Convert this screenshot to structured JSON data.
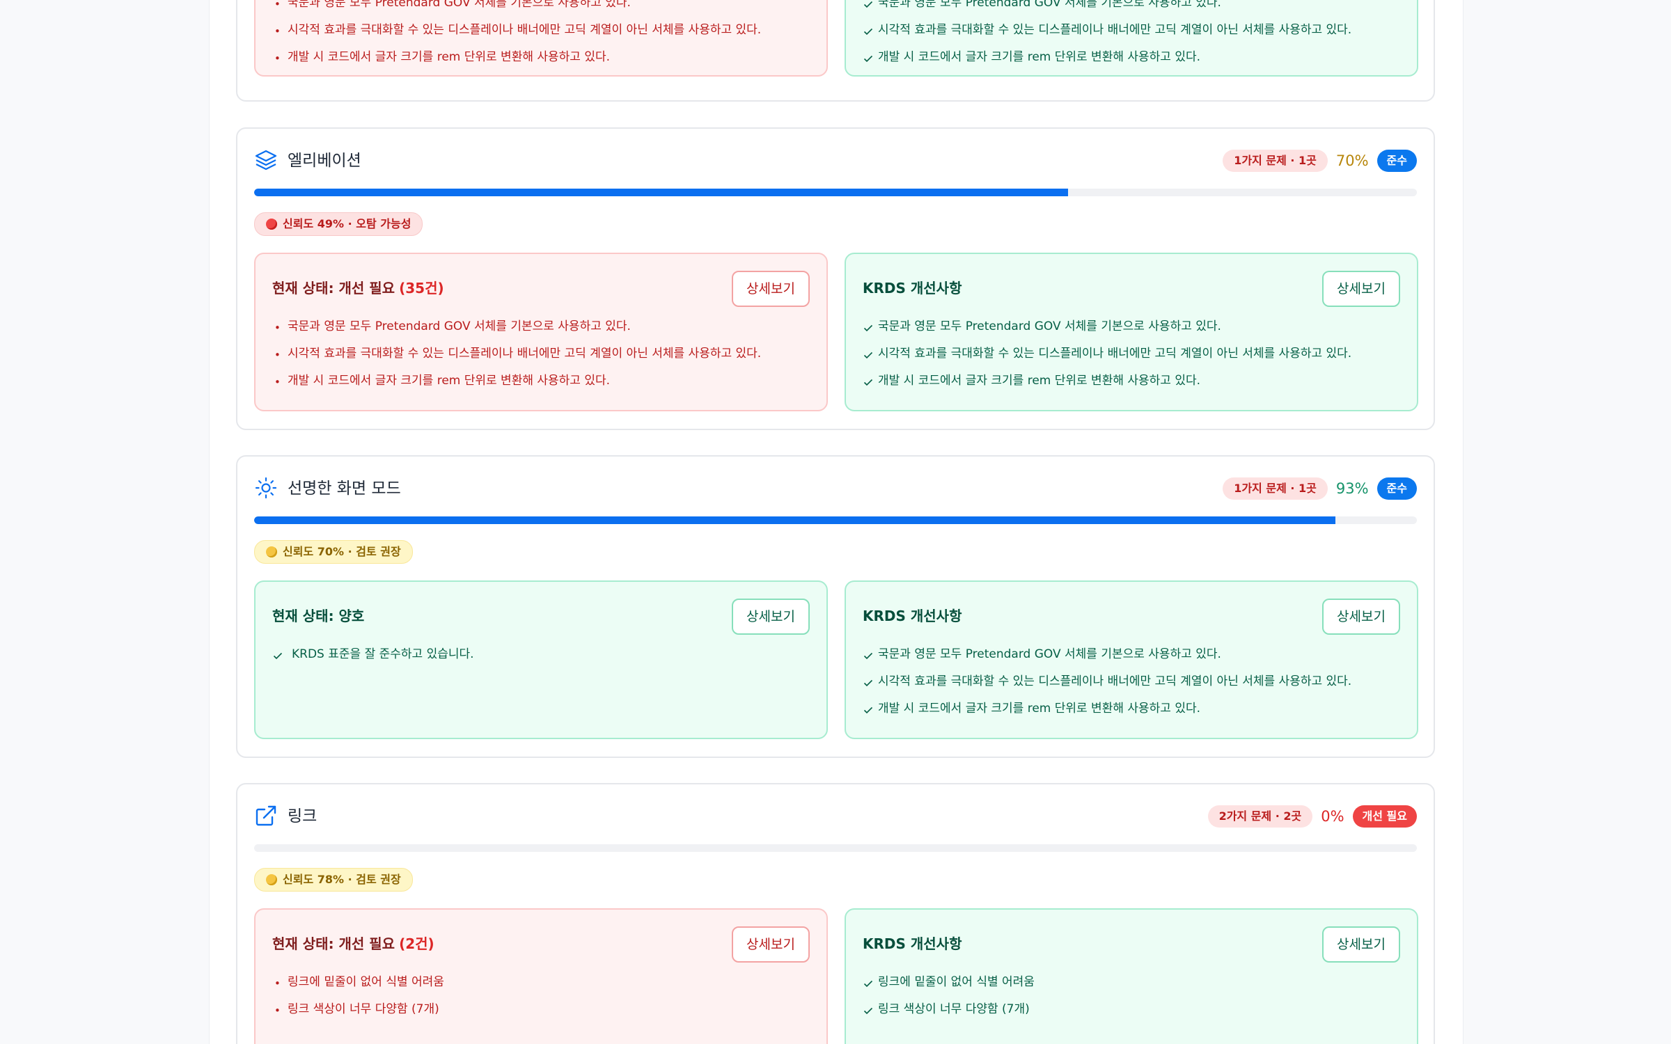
{
  "labels": {
    "details": "상세보기",
    "krds_title": "KRDS 개선사항"
  },
  "cards": [
    {
      "top_clip": true,
      "current": {
        "items": [
          "국문과 영문 모두 Pretendard GOV 서체를 기본으로 사용하고 있다.",
          "시각적 효과를 극대화할 수 있는 디스플레이나 배너에만 고딕 계열이 아닌 서체를 사용하고 있다.",
          "개발 시 코드에서 글자 크기를 rem 단위로 변환해 사용하고 있다."
        ]
      },
      "krds": {
        "items": [
          "국문과 영문 모두 Pretendard GOV 서체를 기본으로 사용하고 있다.",
          "시각적 효과를 극대화할 수 있는 디스플레이나 배너에만 고딕 계열이 아닌 서체를 사용하고 있다.",
          "개발 시 코드에서 글자 크기를 rem 단위로 변환해 사용하고 있다."
        ]
      }
    },
    {
      "title": "엘리베이션",
      "icon": "layers-icon",
      "issues": "1가지 문제 · 1곳",
      "percent": "70%",
      "percent_value": 70,
      "status": "준수",
      "confidence": "신뢰도 49% · 오탐 가능성",
      "current": {
        "title": "현재 상태: 개선 필요",
        "count": "(35건)",
        "items": [
          "국문과 영문 모두 Pretendard GOV 서체를 기본으로 사용하고 있다.",
          "시각적 효과를 극대화할 수 있는 디스플레이나 배너에만 고딕 계열이 아닌 서체를 사용하고 있다.",
          "개발 시 코드에서 글자 크기를 rem 단위로 변환해 사용하고 있다."
        ]
      },
      "krds": {
        "items": [
          "국문과 영문 모두 Pretendard GOV 서체를 기본으로 사용하고 있다.",
          "시각적 효과를 극대화할 수 있는 디스플레이나 배너에만 고딕 계열이 아닌 서체를 사용하고 있다.",
          "개발 시 코드에서 글자 크기를 rem 단위로 변환해 사용하고 있다."
        ]
      }
    },
    {
      "title": "선명한 화면 모드",
      "icon": "sun-icon",
      "issues": "1가지 문제 · 1곳",
      "percent": "93%",
      "percent_value": 93,
      "status": "준수",
      "confidence": "신뢰도 70% · 검토 권장",
      "current": {
        "title": "현재 상태: 양호",
        "items": [
          "KRDS 표준을 잘 준수하고 있습니다."
        ]
      },
      "krds": {
        "items": [
          "국문과 영문 모두 Pretendard GOV 서체를 기본으로 사용하고 있다.",
          "시각적 효과를 극대화할 수 있는 디스플레이나 배너에만 고딕 계열이 아닌 서체를 사용하고 있다.",
          "개발 시 코드에서 글자 크기를 rem 단위로 변환해 사용하고 있다."
        ]
      }
    },
    {
      "title": "링크",
      "icon": "external-link-icon",
      "issues": "2가지 문제 · 2곳",
      "percent": "0%",
      "percent_value": 0,
      "status": "개선 필요",
      "confidence": "신뢰도 78% · 검토 권장",
      "current": {
        "title": "현재 상태: 개선 필요",
        "count": "(2건)",
        "items": [
          "링크에 밑줄이 없어 식별 어려움",
          "링크 색상이 너무 다양함 (7개)"
        ]
      },
      "krds": {
        "items": [
          "링크에 밑줄이 없어 식별 어려움",
          "링크 색상이 너무 다양함 (7개)"
        ]
      }
    }
  ],
  "colors": {
    "primary": "#0b6ff0",
    "danger": "#ef4444",
    "success_text": "#065f46",
    "danger_text": "#b91c1c"
  }
}
